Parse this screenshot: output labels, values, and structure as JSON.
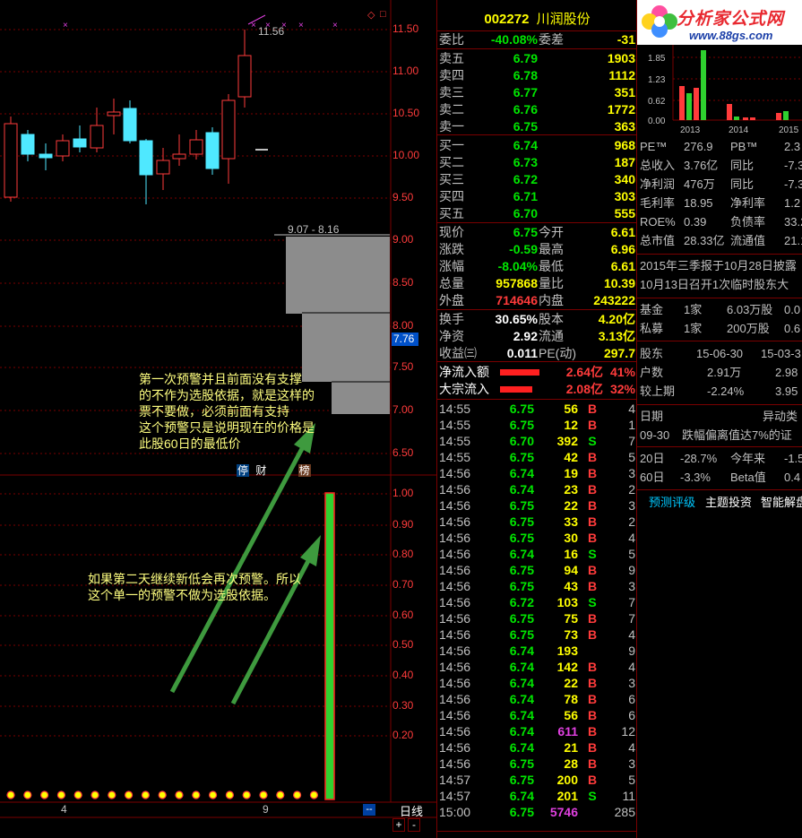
{
  "stock": {
    "code": "002272",
    "name": "川润股份"
  },
  "price_axis": [
    "11.50",
    "11.00",
    "10.50",
    "10.00",
    "9.50",
    "9.00",
    "8.50",
    "8.00",
    "7.50",
    "7.00",
    "6.50"
  ],
  "price_current_tag": "7.76",
  "high_label": "11.56",
  "range_label": "9.07 - 8.16",
  "event_tags": [
    "停",
    "财",
    "榜"
  ],
  "indicator_axis": [
    "1.00",
    "0.90",
    "0.80",
    "0.70",
    "0.60",
    "0.50",
    "0.40",
    "0.30",
    "0.20"
  ],
  "bottom_axis_ticks": [
    "4",
    "9"
  ],
  "bottom_axis_more": "--",
  "period_label": "日线",
  "zoom_plus": "+",
  "zoom_minus": "-",
  "note1": "第一次预警并且前面没有支撑\n的不作为选股依据，就是这样的\n票不要做，必须前面有支持\n这个预警只是说明现在的价格是\n此股60日的最低价",
  "note2": "如果第二天继续新低会再次预警。所以\n这个单一的预警不做为选股依据。",
  "quote": {
    "wei_bi_label": "委比",
    "wei_bi": "-40.08%",
    "wei_cha_label": "委差",
    "wei_cha": "-31",
    "asks": [
      {
        "label": "卖五",
        "price": "6.79",
        "vol": "1903"
      },
      {
        "label": "卖四",
        "price": "6.78",
        "vol": "1112"
      },
      {
        "label": "卖三",
        "price": "6.77",
        "vol": "351"
      },
      {
        "label": "卖二",
        "price": "6.76",
        "vol": "1772"
      },
      {
        "label": "卖一",
        "price": "6.75",
        "vol": "363"
      }
    ],
    "bids": [
      {
        "label": "买一",
        "price": "6.74",
        "vol": "968"
      },
      {
        "label": "买二",
        "price": "6.73",
        "vol": "187"
      },
      {
        "label": "买三",
        "price": "6.72",
        "vol": "340"
      },
      {
        "label": "买四",
        "price": "6.71",
        "vol": "303"
      },
      {
        "label": "买五",
        "price": "6.70",
        "vol": "555"
      }
    ],
    "stats": [
      {
        "l1": "现价",
        "v1": "6.75",
        "c1": "green",
        "l2": "今开",
        "v2": "6.61",
        "c2": "green"
      },
      {
        "l1": "涨跌",
        "v1": "-0.59",
        "c1": "green",
        "l2": "最高",
        "v2": "6.96",
        "c2": "green"
      },
      {
        "l1": "涨幅",
        "v1": "-8.04%",
        "c1": "green",
        "l2": "最低",
        "v2": "6.61",
        "c2": "green"
      },
      {
        "l1": "总量",
        "v1": "957868",
        "c1": "yellow",
        "l2": "量比",
        "v2": "10.39",
        "c2": "magenta"
      },
      {
        "l1": "外盘",
        "v1": "714646",
        "c1": "red",
        "l2": "内盘",
        "v2": "243222",
        "c2": "green"
      }
    ],
    "stats2": [
      {
        "l1": "换手",
        "v1": "30.65%",
        "l2": "股本",
        "v2": "4.20亿"
      },
      {
        "l1": "净资",
        "v1": "2.92",
        "l2": "流通",
        "v2": "3.13亿"
      },
      {
        "l1": "收益㈢",
        "v1": "0.011",
        "l2": "PE(动)",
        "v2": "297.7"
      }
    ],
    "flows": [
      {
        "label": "净流入额",
        "value": "2.64亿",
        "pct": "41%"
      },
      {
        "label": "大宗流入",
        "value": "2.08亿",
        "pct": "32%"
      }
    ]
  },
  "ticks": [
    {
      "t": "14:55",
      "p": "6.75",
      "v": "56",
      "bs": "B",
      "n": "4"
    },
    {
      "t": "14:55",
      "p": "6.75",
      "v": "12",
      "bs": "B",
      "n": "1"
    },
    {
      "t": "14:55",
      "p": "6.70",
      "v": "392",
      "bs": "S",
      "n": "7"
    },
    {
      "t": "14:55",
      "p": "6.75",
      "v": "42",
      "bs": "B",
      "n": "5"
    },
    {
      "t": "14:56",
      "p": "6.74",
      "v": "19",
      "bs": "B",
      "n": "3"
    },
    {
      "t": "14:56",
      "p": "6.74",
      "v": "23",
      "bs": "B",
      "n": "2"
    },
    {
      "t": "14:56",
      "p": "6.75",
      "v": "22",
      "bs": "B",
      "n": "3"
    },
    {
      "t": "14:56",
      "p": "6.75",
      "v": "33",
      "bs": "B",
      "n": "2"
    },
    {
      "t": "14:56",
      "p": "6.75",
      "v": "30",
      "bs": "B",
      "n": "4"
    },
    {
      "t": "14:56",
      "p": "6.74",
      "v": "16",
      "bs": "S",
      "n": "5"
    },
    {
      "t": "14:56",
      "p": "6.75",
      "v": "94",
      "bs": "B",
      "n": "9"
    },
    {
      "t": "14:56",
      "p": "6.75",
      "v": "43",
      "bs": "B",
      "n": "3"
    },
    {
      "t": "14:56",
      "p": "6.72",
      "v": "103",
      "bs": "S",
      "n": "7"
    },
    {
      "t": "14:56",
      "p": "6.75",
      "v": "75",
      "bs": "B",
      "n": "7"
    },
    {
      "t": "14:56",
      "p": "6.75",
      "v": "73",
      "bs": "B",
      "n": "4"
    },
    {
      "t": "14:56",
      "p": "6.74",
      "v": "193",
      "bs": "",
      "n": "9"
    },
    {
      "t": "14:56",
      "p": "6.74",
      "v": "142",
      "bs": "B",
      "n": "4"
    },
    {
      "t": "14:56",
      "p": "6.74",
      "v": "22",
      "bs": "B",
      "n": "3"
    },
    {
      "t": "14:56",
      "p": "6.74",
      "v": "78",
      "bs": "B",
      "n": "6"
    },
    {
      "t": "14:56",
      "p": "6.74",
      "v": "56",
      "bs": "B",
      "n": "6"
    },
    {
      "t": "14:56",
      "p": "6.74",
      "v": "611",
      "bs": "B",
      "n": "12"
    },
    {
      "t": "14:56",
      "p": "6.74",
      "v": "21",
      "bs": "B",
      "n": "4"
    },
    {
      "t": "14:56",
      "p": "6.75",
      "v": "28",
      "bs": "B",
      "n": "3"
    },
    {
      "t": "14:57",
      "p": "6.75",
      "v": "200",
      "bs": "B",
      "n": "5"
    },
    {
      "t": "14:57",
      "p": "6.74",
      "v": "201",
      "bs": "S",
      "n": "11"
    },
    {
      "t": "15:00",
      "p": "6.75",
      "v": "5746",
      "bs": "",
      "n": "285"
    }
  ],
  "logo": {
    "title": "分析家公式网",
    "url": "www.88gs.com"
  },
  "fin_chart": {
    "y_ticks": [
      "1.85",
      "1.23",
      "0.62",
      "0.00"
    ],
    "years": [
      "2013",
      "2014",
      "2015"
    ]
  },
  "info": {
    "rows1": [
      {
        "a": "PE™",
        "b": "276.9",
        "c": "PB™",
        "d": "2.3"
      },
      {
        "a": "总收入",
        "b": "3.76亿",
        "c": "同比",
        "d": "-7.3"
      },
      {
        "a": "净利润",
        "b": "476万",
        "c": "同比",
        "d": "-7.3"
      },
      {
        "a": "毛利率",
        "b": "18.95",
        "c": "净利率",
        "d": "1.2"
      },
      {
        "a": "ROE%",
        "b": "0.39",
        "c": "负债率",
        "d": "33.2"
      },
      {
        "a": "总市值",
        "b": "28.33亿",
        "c": "流通值",
        "d": "21.10"
      }
    ],
    "news1": "2015年三季报于10月28日披露",
    "news2": "10月13日召开1次临时股东大",
    "funds": [
      {
        "a": "基金",
        "b": "1家",
        "c": "6.03万股",
        "d": "0.0"
      },
      {
        "a": "私募",
        "b": "1家",
        "c": "200万股",
        "d": "0.6"
      }
    ],
    "holders_header": {
      "a": "股东",
      "b": "15-06-30",
      "c": "15-03-3"
    },
    "holders": [
      {
        "a": "户数",
        "b": "2.91万",
        "c": "2.98"
      },
      {
        "a": "较上期",
        "b": "-2.24%",
        "c": "3.95"
      }
    ],
    "date_header": {
      "a": "日期",
      "b": "异动类"
    },
    "date_row": {
      "a": "09-30",
      "b": "跌幅偏离值达7%的证"
    },
    "perf": [
      {
        "a": "20日",
        "b": "-28.7%",
        "c": "今年来",
        "d": "-1.5"
      },
      {
        "a": "60日",
        "b": "-3.3%",
        "c": "Beta值",
        "d": "0.4"
      }
    ],
    "tabs": [
      "预测评级",
      "主题投资",
      "智能解盘"
    ]
  }
}
